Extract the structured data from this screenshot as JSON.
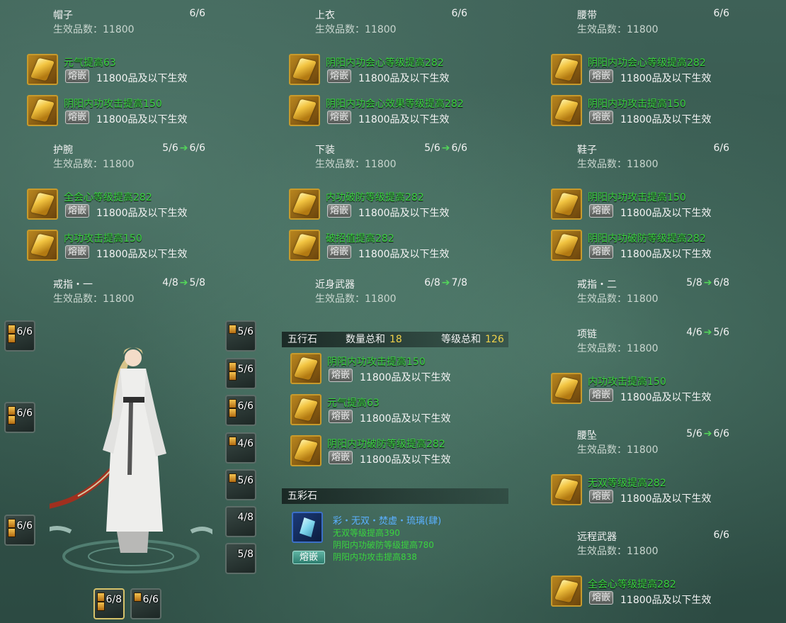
{
  "eff_label": "生效品数：",
  "socket_label": "熔嵌",
  "sections": [
    {
      "title": "帽子",
      "level": "6/6",
      "eff": "11800",
      "stones": [
        {
          "name": "元气提高63",
          "cond": "11800品及以下生效"
        },
        {
          "name": "阴阳内功攻击提高150",
          "cond": "11800品及以下生效"
        }
      ]
    },
    {
      "title": "上衣",
      "level": "6/6",
      "eff": "11800",
      "stones": [
        {
          "name": "阴阳内功会心等级提高282",
          "cond": "11800品及以下生效"
        },
        {
          "name": "阴阳内功会心效果等级提高282",
          "cond": "11800品及以下生效"
        }
      ]
    },
    {
      "title": "腰带",
      "level": "6/6",
      "eff": "11800",
      "stones": [
        {
          "name": "阴阳内功会心等级提高282",
          "cond": "11800品及以下生效"
        },
        {
          "name": "阴阳内功攻击提高150",
          "cond": "11800品及以下生效"
        }
      ]
    },
    {
      "title": "护腕",
      "level": "5/6",
      "level_next": "6/6",
      "eff": "11800",
      "stones": [
        {
          "name": "全会心等级提高282",
          "cond": "11800品及以下生效"
        },
        {
          "name": "内功攻击提高150",
          "cond": "11800品及以下生效"
        }
      ]
    },
    {
      "title": "下装",
      "level": "5/6",
      "level_next": "6/6",
      "eff": "11800",
      "stones": [
        {
          "name": "内功破防等级提高282",
          "cond": "11800品及以下生效"
        },
        {
          "name": "破招值提高282",
          "cond": "11800品及以下生效"
        }
      ]
    },
    {
      "title": "鞋子",
      "level": "6/6",
      "eff": "11800",
      "stones": [
        {
          "name": "阴阳内功攻击提高150",
          "cond": "11800品及以下生效"
        },
        {
          "name": "阴阳内功破防等级提高282",
          "cond": "11800品及以下生效"
        }
      ]
    },
    {
      "title": "戒指・一",
      "level": "4/8",
      "level_next": "5/8",
      "eff": "11800",
      "stones": []
    },
    {
      "title": "近身武器",
      "level": "6/8",
      "level_next": "7/8",
      "eff": "11800",
      "stones": []
    },
    {
      "title": "戒指・二",
      "level": "5/8",
      "level_next": "6/8",
      "eff": "11800",
      "stones": []
    },
    {
      "title": "项链",
      "level": "4/6",
      "level_next": "5/6",
      "eff": "11800",
      "stones": [
        {
          "name": "内功攻击提高150",
          "cond": "11800品及以下生效"
        }
      ]
    },
    {
      "title": "腰坠",
      "level": "5/6",
      "level_next": "6/6",
      "eff": "11800",
      "stones": [
        {
          "name": "无双等级提高282",
          "cond": "11800品及以下生效"
        }
      ]
    },
    {
      "title": "远程武器",
      "level": "6/6",
      "eff": "11800",
      "stones": [
        {
          "name": "全会心等级提高282",
          "cond": "11800品及以下生效"
        }
      ]
    }
  ],
  "wuxing": {
    "title": "五行石",
    "count_label": "数量总和",
    "count": "18",
    "level_label": "等级总和",
    "level": "126",
    "stones": [
      {
        "name": "阴阳内功攻击提高150",
        "cond": "11800品及以下生效"
      },
      {
        "name": "元气提高63",
        "cond": "11800品及以下生效"
      },
      {
        "name": "阴阳内功破防等级提高282",
        "cond": "11800品及以下生效"
      }
    ]
  },
  "wucai": {
    "title": "五彩石",
    "name": "彩・无双・焚虚・琉璃(肆)",
    "effects": [
      "无双等级提高390",
      "阴阳内功破防等级提高780",
      "阴阳内功攻击提高838"
    ],
    "button": "熔嵌"
  },
  "slots_left": [
    "6/6",
    "6/6",
    "6/6"
  ],
  "slots_right": [
    "5/6",
    "5/6",
    "6/6",
    "4/6",
    "5/6",
    "4/8",
    "5/8"
  ],
  "slots_bottom": [
    "6/8",
    "6/6"
  ],
  "colors": {
    "stone_name": "#3ad43f",
    "arrow": "#53d65a",
    "accent": "#f0d24a"
  }
}
